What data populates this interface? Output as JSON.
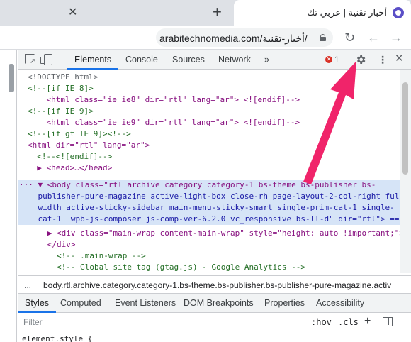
{
  "browser": {
    "tab_title": "أخبار تقنية | عربي تك",
    "url": "arabitechnomedia.com/أخبار-تقنية/",
    "icons": [
      "close-icon",
      "new-tab-icon",
      "lock-icon",
      "reload-icon",
      "back-icon",
      "forward-icon"
    ]
  },
  "devtools": {
    "tabs": [
      "Elements",
      "Console",
      "Sources",
      "Network",
      "»"
    ],
    "active_tab": "Elements",
    "error_count": "1",
    "code_lines": [
      "<!DOCTYPE html>",
      "<!--[if IE 8]>",
      "    <html class=\"ie ie8\" dir=\"rtl\" lang=\"ar\"> <![endif]-->",
      "<!--[if IE 9]>",
      "    <html class=\"ie ie9\" dir=\"rtl\" lang=\"ar\"> <![endif]-->",
      "<!--[if gt IE 9]><!-->",
      "<html dir=\"rtl\" lang=\"ar\">",
      "  <!--<![endif]-->",
      "  ▶ <head>…</head>",
      "··· ▼ <body class=\"rtl archive category category-1 bs-theme bs-publisher bs-",
      "    publisher-pure-magazine active-light-box close-rh page-layout-2-col-right full-",
      "    width active-sticky-sidebar main-menu-sticky-smart single-prim-cat-1 single-",
      "    cat-1  wpb-js-composer js-comp-ver-6.2.0 vc_responsive bs-ll-d\" dir=\"rtl\"> == $",
      "      ▶ <div class=\"main-wrap content-main-wrap\" style=\"height: auto !important;\">…</",
      "      </div>",
      "        <!-- .main-wrap -->",
      "        <!-- Global site tag (gtag.js) - Google Analytics -->"
    ],
    "breadcrumb_dots": "...",
    "breadcrumb": "body.rtl.archive.category.category-1.bs-theme.bs-publisher.bs-publisher-pure-magazine.activ",
    "sub_tabs": [
      "Styles",
      "Computed",
      "Event Listeners",
      "DOM Breakpoints",
      "Properties",
      "Accessibility"
    ],
    "active_sub_tab": "Styles",
    "filter_placeholder": "Filter",
    "hov_label": ":hov",
    "cls_label": ".cls",
    "plus_label": "+",
    "element_style": "element.style {"
  },
  "annotation": {
    "arrow_color": "#f0246a",
    "points_to": "gear-icon"
  },
  "colors": {
    "selected_row": "#d6e4f7",
    "active_tab_underline": "#1a73e8"
  }
}
